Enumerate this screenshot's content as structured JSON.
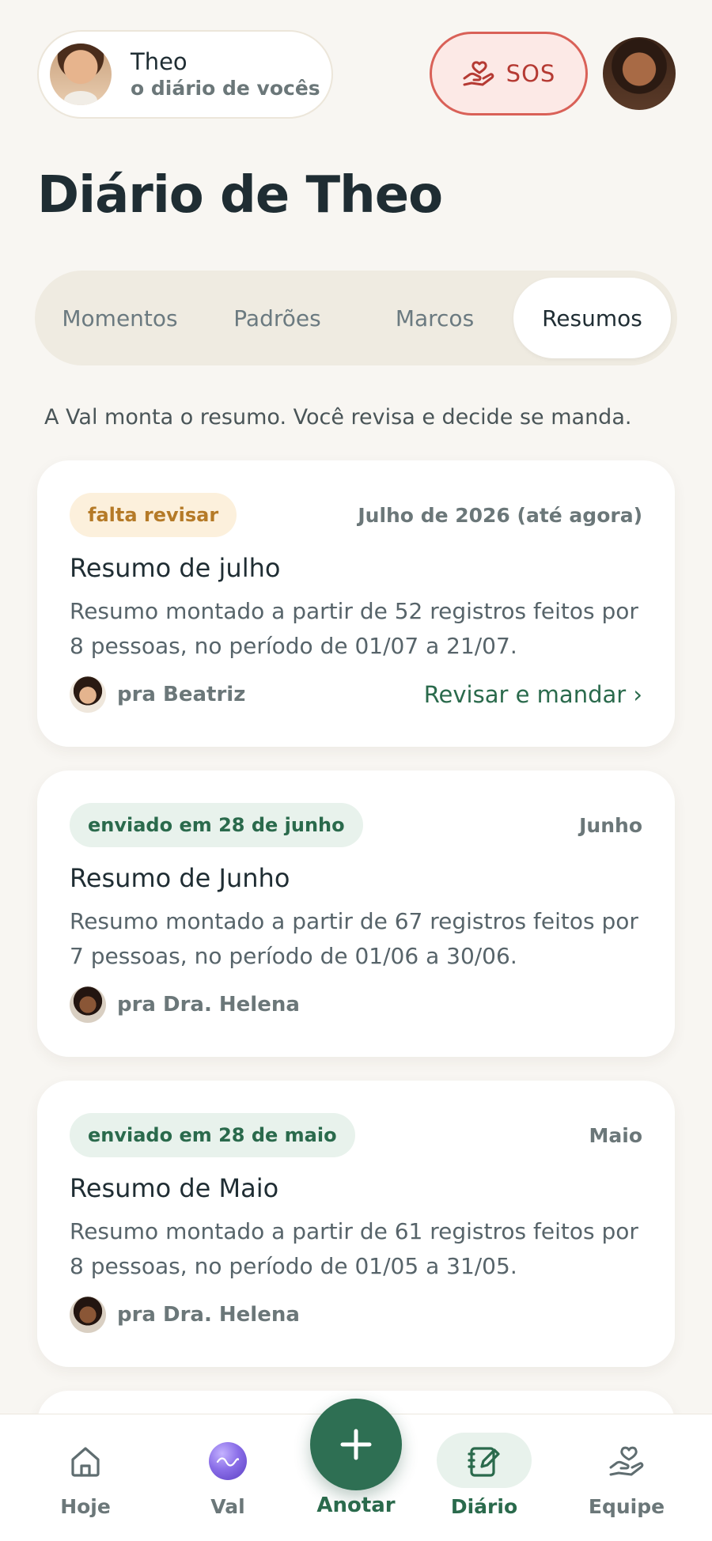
{
  "header": {
    "child_name": "Theo",
    "child_subtitle": "o diário de vocês",
    "sos_label": "SOS"
  },
  "page_title": "Diário de Theo",
  "tabs": [
    {
      "label": "Momentos",
      "active": false
    },
    {
      "label": "Padrões",
      "active": false
    },
    {
      "label": "Marcos",
      "active": false
    },
    {
      "label": "Resumos",
      "active": true
    }
  ],
  "intro": "A Val monta o resumo. Você revisa e decide se manda.",
  "summaries": [
    {
      "badge": "falta revisar",
      "status": "pending",
      "period": "Julho de 2026 (até agora)",
      "title": "Resumo de julho",
      "description": "Resumo montado a partir de 52 registros feitos por 8 pessoas, no período de 01/07 a 21/07.",
      "recipient": "pra Beatriz",
      "action": "Revisar e mandar ›"
    },
    {
      "badge": "enviado em 28 de junho",
      "status": "sent",
      "period": "Junho",
      "title": "Resumo de Junho",
      "description": "Resumo montado a partir de 67 registros feitos por 7 pessoas, no período de 01/06 a 30/06.",
      "recipient": "pra Dra. Helena"
    },
    {
      "badge": "enviado em 28 de maio",
      "status": "sent",
      "period": "Maio",
      "title": "Resumo de Maio",
      "description": "Resumo montado a partir de 61 registros feitos por 8 pessoas, no período de 01/05 a 31/05.",
      "recipient": "pra Dra. Helena"
    }
  ],
  "nav": {
    "home": "Hoje",
    "val": "Val",
    "add": "Anotar",
    "diary": "Diário",
    "team": "Equipe"
  },
  "colors": {
    "accent_green": "#2e6f53",
    "sos_red": "#d96158",
    "pending_amber": "#b57a27",
    "background": "#f8f6f2"
  },
  "icons": {
    "sos": "hand-heart-icon",
    "home": "house-icon",
    "val": "val-orb-icon",
    "add": "plus-icon",
    "diary": "notebook-pencil-icon",
    "team": "hand-heart-icon"
  }
}
